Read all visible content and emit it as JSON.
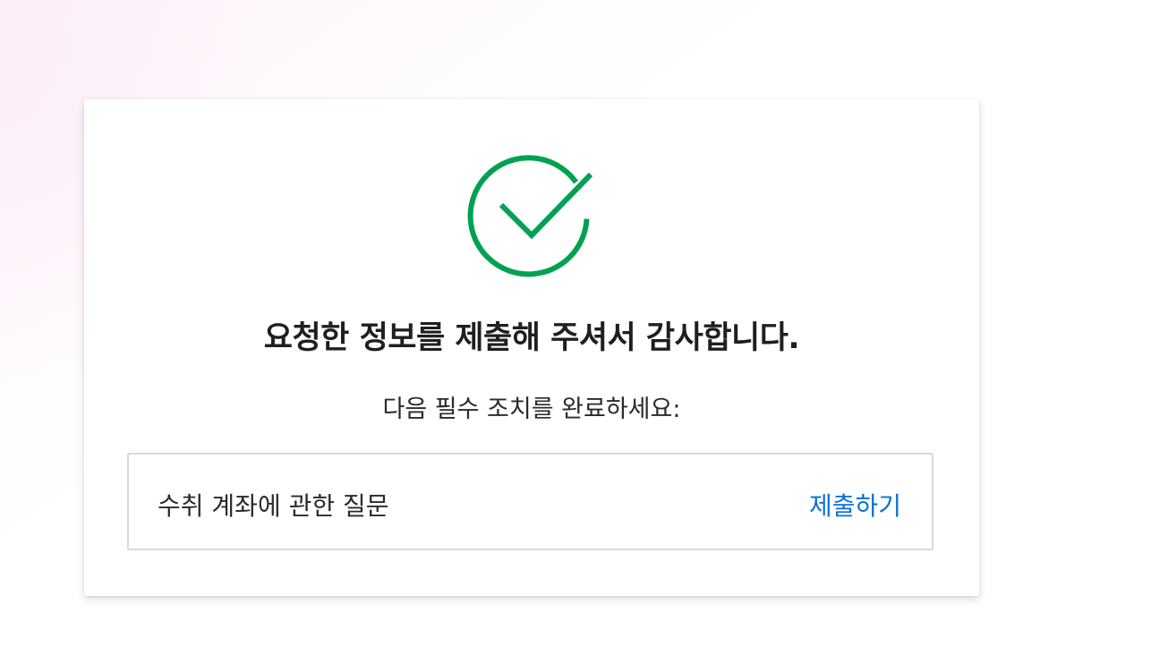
{
  "confirmation": {
    "icon": "check-circle-icon",
    "icon_color": "#00a150",
    "title": "요청한 정보를 제출해 주셔서 감사합니다.",
    "subtitle": "다음 필수 조치를 완료하세요:"
  },
  "tasks": [
    {
      "label": "수취 계좌에 관한 질문",
      "action_label": "제출하기",
      "action_color": "#0a6fd6"
    }
  ]
}
